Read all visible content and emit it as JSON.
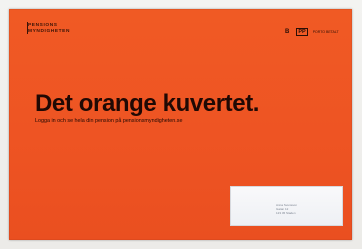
{
  "logo": {
    "line1": "PENSIONS",
    "line2": "MYNDIGHETEN"
  },
  "postage": {
    "letter": "B",
    "mark": "PP",
    "small": "PORTO BETALT"
  },
  "headline": "Det orange kuvertet.",
  "subline": "Logga in och se hela din pension på pensionsmyndigheten.se",
  "address_window": {
    "line1": "Anna Svensson",
    "line2": "Gatan 12",
    "line3": "123 45 Staden"
  },
  "colors": {
    "envelope": "#ee5522",
    "text": "#200904",
    "window": "#f4f5f8"
  }
}
